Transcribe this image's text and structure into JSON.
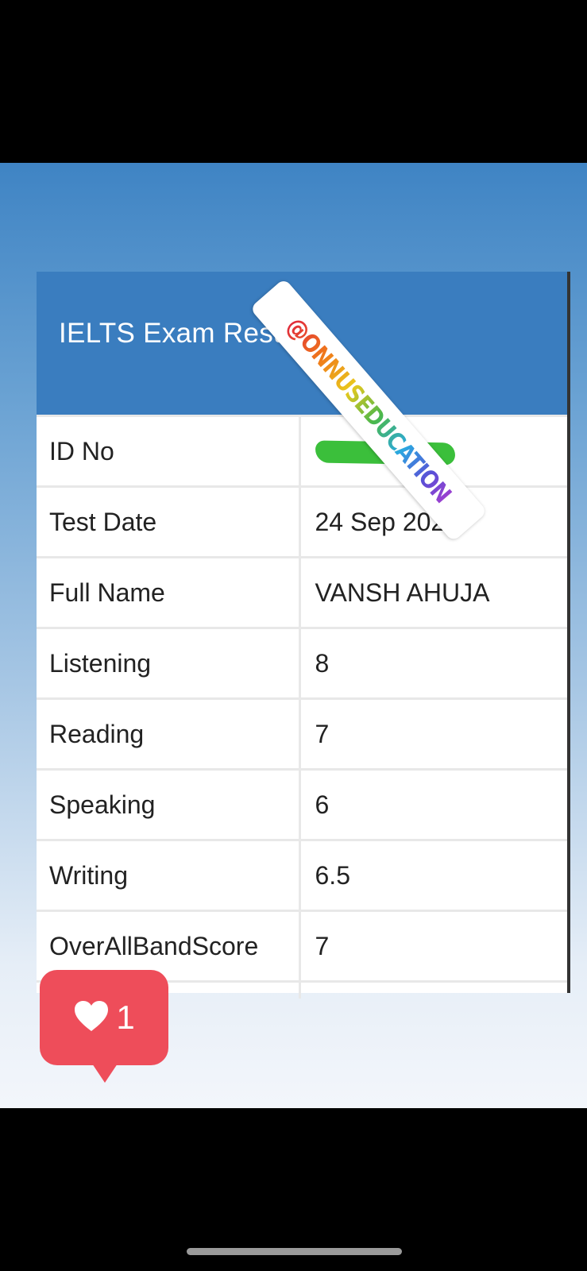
{
  "panel": {
    "title": "IELTS Exam Results",
    "rows": [
      {
        "label": "ID No",
        "value": ""
      },
      {
        "label": "Test Date",
        "value": "24 Sep 2022"
      },
      {
        "label": "Full Name",
        "value": "VANSH AHUJA"
      },
      {
        "label": "Listening",
        "value": "8"
      },
      {
        "label": "Reading",
        "value": "7"
      },
      {
        "label": "Speaking",
        "value": "6"
      },
      {
        "label": "Writing",
        "value": "6.5"
      },
      {
        "label": "OverAllBandScore",
        "value": "7"
      }
    ]
  },
  "watermark": {
    "text": "@ONNUSEDUCATION"
  },
  "like_badge": {
    "icon": "heart-icon",
    "count": "1",
    "color": "#ee4d5a"
  },
  "colors": {
    "header": "#3a7dbf",
    "redaction": "#3bbf3b"
  }
}
